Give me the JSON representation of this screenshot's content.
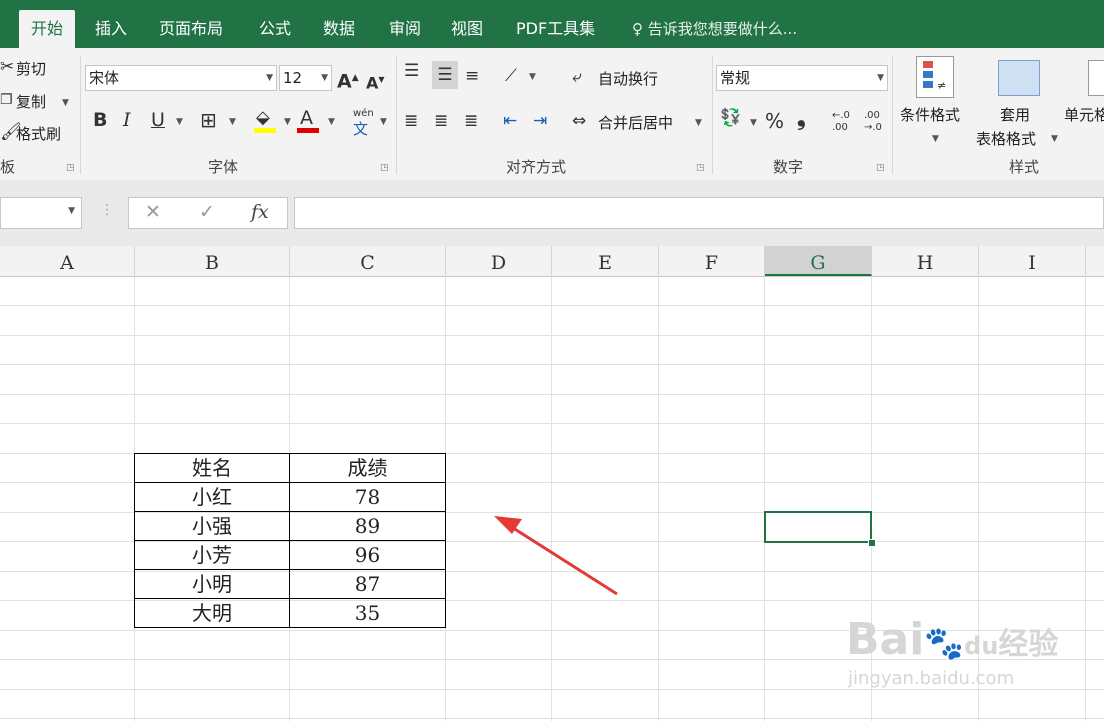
{
  "tabs": [
    "开始",
    "插入",
    "页面布局",
    "公式",
    "数据",
    "审阅",
    "视图",
    "PDF工具集"
  ],
  "tell_me": "告诉我您想要做什么...",
  "clipboard": {
    "cut": "剪切",
    "copy": "复制",
    "format_painter": "格式刷",
    "label": "板"
  },
  "font": {
    "name": "宋体",
    "size": "12",
    "label": "字体",
    "bold": "B",
    "italic": "I",
    "underline": "U",
    "grow": "A",
    "shrink": "A",
    "phonetic_top": "wén",
    "phonetic_bottom": "文"
  },
  "alignment": {
    "wrap": "自动换行",
    "merge": "合并后居中",
    "label": "对齐方式"
  },
  "number": {
    "format": "常规",
    "percent": "%",
    "comma": "❟",
    "inc_dec_top": "←.0",
    "inc_dec_bot": ".00",
    "dec_dec_top": ".00",
    "dec_dec_bot": "→.0",
    "label": "数字"
  },
  "styles": {
    "conditional": "条件格式",
    "table_line1": "套用",
    "table_line2": "表格格式",
    "cell": "单元格",
    "label": "样式"
  },
  "formula_bar": {
    "fx": "fx",
    "cancel": "✕",
    "enter": "✓"
  },
  "columns": [
    "A",
    "B",
    "C",
    "D",
    "E",
    "F",
    "G",
    "H",
    "I"
  ],
  "selected_column": "G",
  "table": {
    "headers": [
      "姓名",
      "成绩"
    ],
    "rows": [
      [
        "小红",
        "78"
      ],
      [
        "小强",
        "89"
      ],
      [
        "小芳",
        "96"
      ],
      [
        "小明",
        "87"
      ],
      [
        "大明",
        "35"
      ]
    ]
  },
  "colors": {
    "accent": "#217346",
    "arrow": "#e53935"
  },
  "watermark": {
    "brand": "Bai",
    "brand_cn": "经验",
    "url": "jingyan.baidu.com"
  }
}
